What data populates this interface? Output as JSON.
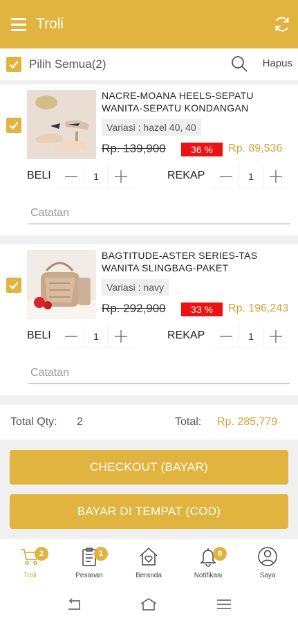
{
  "header": {
    "title": "Troli"
  },
  "toolbar": {
    "select_all_label": "Pilih Semua(2)",
    "delete_label": "Hapus"
  },
  "cart_items": [
    {
      "name": "NACRE-MOANA HEELS-SEPATU WANITA-SEPATU KONDANGAN",
      "variant": "Variasi : hazel 40, 40",
      "old_price": "Rp. 139,900",
      "discount": "36 %",
      "price": "Rp. 89,536",
      "beli_label": "BELI",
      "beli_qty": "1",
      "rekap_label": "REKAP",
      "rekap_qty": "1",
      "note_placeholder": "Catatan",
      "checked": true
    },
    {
      "name": "BAGTITUDE-ASTER SERIES-TAS WANITA SLINGBAG-PAKET",
      "variant": "Variasi : navy",
      "old_price": "Rp. 292,900",
      "discount": "33 %",
      "price": "Rp. 196,243",
      "beli_label": "BELI",
      "beli_qty": "1",
      "rekap_label": "REKAP",
      "rekap_qty": "1",
      "note_placeholder": "Catatan",
      "checked": true
    }
  ],
  "summary": {
    "total_qty_label": "Total Qty:",
    "total_qty": "2",
    "total_label": "Total:",
    "total_value": "Rp. 285,779"
  },
  "buttons": {
    "checkout": "CHECKOUT (BAYAR)",
    "cod": "BAYAR DI TEMPAT (COD)"
  },
  "nav": [
    {
      "label": "Troli",
      "icon": "cart-icon",
      "badge": "2",
      "active": true
    },
    {
      "label": "Pesanan",
      "icon": "clipboard-icon",
      "badge": "1",
      "active": false
    },
    {
      "label": "Beranda",
      "icon": "home-heart-icon",
      "badge": "",
      "active": false
    },
    {
      "label": "Notifikasi",
      "icon": "bell-icon",
      "badge": "9",
      "active": false
    },
    {
      "label": "Saya",
      "icon": "user-icon",
      "badge": "",
      "active": false
    }
  ],
  "colors": {
    "accent": "#e1b33f",
    "price": "#d4a233",
    "discount_bg": "#ee1111"
  }
}
